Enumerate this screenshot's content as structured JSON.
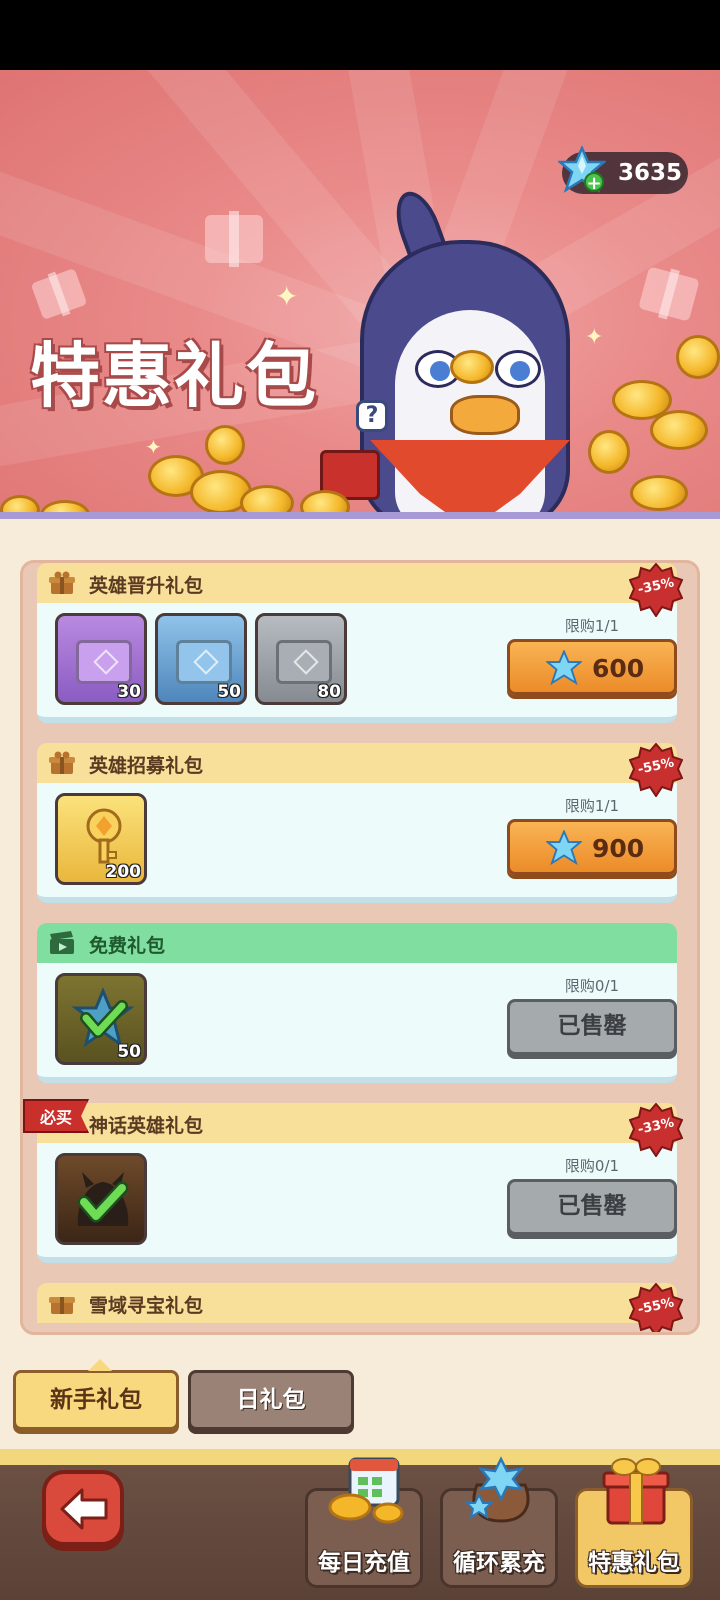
{
  "currency": {
    "icon": "crystal-icon",
    "value": "3635"
  },
  "banner": {
    "title": "特惠礼包"
  },
  "packs": [
    {
      "title": "英雄晋升礼包",
      "discount": "-35%",
      "limit": "限购1/1",
      "price": "600",
      "items": [
        "30",
        "50",
        "80"
      ]
    },
    {
      "title": "英雄招募礼包",
      "discount": "-55%",
      "limit": "限购1/1",
      "price": "900",
      "items": [
        "200"
      ]
    },
    {
      "title": "免费礼包",
      "limit": "限购0/1",
      "status": "已售罄",
      "items": [
        "50"
      ]
    },
    {
      "title": "神话英雄礼包",
      "discount": "-33%",
      "tag": "必买",
      "limit": "限购0/1",
      "status": "已售罄"
    },
    {
      "title": "雪域寻宝礼包",
      "discount": "-55%"
    }
  ],
  "tabs": [
    {
      "label": "新手礼包",
      "active": true
    },
    {
      "label": "日礼包",
      "active": false
    }
  ],
  "nav": [
    {
      "label": "每日充值"
    },
    {
      "label": "循环累充"
    },
    {
      "label": "特惠礼包",
      "active": true
    }
  ],
  "colors": {
    "accent": "#ec8b29",
    "banner": "#e98a89",
    "sold": "#a5aaad",
    "free_header": "#80dea0"
  }
}
